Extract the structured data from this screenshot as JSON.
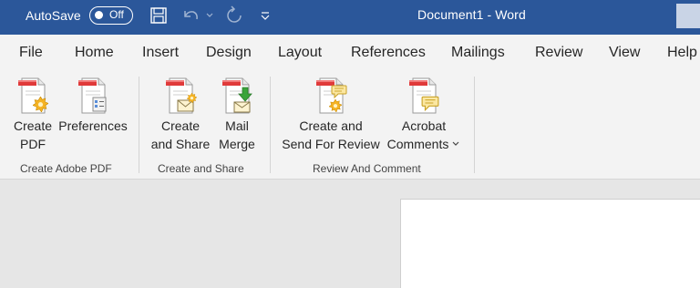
{
  "titlebar": {
    "autosave_label": "AutoSave",
    "autosave_state": "Off",
    "document_title": "Document1  -  Word",
    "colors": {
      "background": "#2b579a"
    },
    "icons": [
      "save-icon",
      "undo-icon",
      "redo-icon",
      "customize-qat-icon"
    ]
  },
  "tabs": [
    "File",
    "Home",
    "Insert",
    "Design",
    "Layout",
    "References",
    "Mailings",
    "Review",
    "View",
    "Help"
  ],
  "ribbon": {
    "groups": [
      {
        "label": "Create Adobe PDF",
        "buttons": [
          {
            "line1": "Create",
            "line2": "PDF",
            "icon": "create-pdf-icon"
          },
          {
            "line1": "Preferences",
            "line2": "",
            "icon": "preferences-icon"
          }
        ]
      },
      {
        "label": "Create and Share",
        "buttons": [
          {
            "line1": "Create",
            "line2": "and Share",
            "icon": "create-and-share-icon"
          },
          {
            "line1": "Mail",
            "line2": "Merge",
            "icon": "mail-merge-icon"
          }
        ]
      },
      {
        "label": "Review And Comment",
        "buttons": [
          {
            "line1": "Create and",
            "line2": "Send For Review",
            "icon": "send-for-review-icon"
          },
          {
            "line1": "Acrobat",
            "line2": "Comments",
            "icon": "acrobat-comments-icon",
            "has_dropdown": true
          }
        ]
      }
    ]
  }
}
